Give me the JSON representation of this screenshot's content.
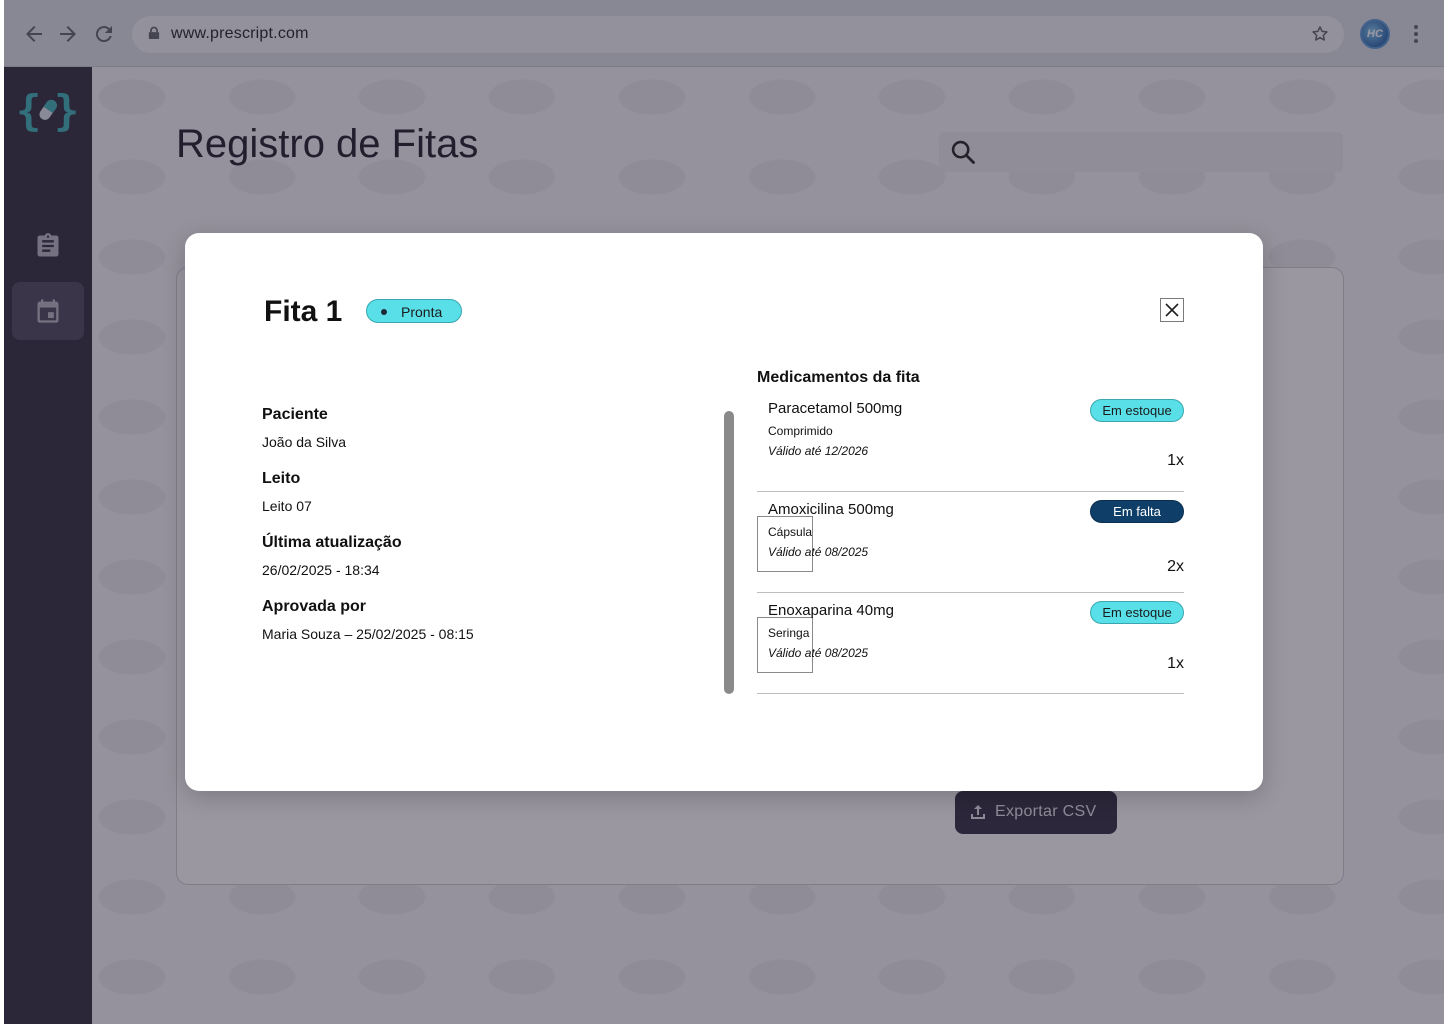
{
  "browser": {
    "url": "www.prescript.com",
    "avatar_initials": "HC"
  },
  "page": {
    "title": "Registro de Fitas",
    "search_placeholder": "",
    "export_label": "Exportar CSV"
  },
  "sidebar": {
    "items": [
      {
        "name": "clipboard-icon",
        "active": false
      },
      {
        "name": "calendar-icon",
        "active": true
      }
    ]
  },
  "modal": {
    "title": "Fita 1",
    "status": "Pronta",
    "fields": [
      {
        "label": "Paciente",
        "value": "João da Silva"
      },
      {
        "label": "Leito",
        "value": "Leito 07"
      },
      {
        "label": "Última atualização",
        "value": "26/02/2025 - 18:34"
      },
      {
        "label": "Aprovada por",
        "value": "Maria Souza – 25/02/2025 - 08:15"
      }
    ],
    "meds_title": "Medicamentos da fita",
    "meds": [
      {
        "name": "Paracetamol 500mg",
        "form": "Comprimido",
        "valid": "Válido até 12/2026",
        "status": "Em estoque",
        "qty": "1x"
      },
      {
        "name": "Amoxicilina 500mg",
        "form": "Cápsula",
        "valid": "Válido até 08/2025",
        "status": "Em falta",
        "qty": "2x"
      },
      {
        "name": "Enoxaparina 40mg",
        "form": "Seringa",
        "valid": "Válido até 08/2025",
        "status": "Em estoque",
        "qty": "1x"
      }
    ]
  },
  "colors": {
    "sidebar": "#2f2c3b",
    "accent_cyan": "#58dfe8",
    "status_out": "#0f3e68",
    "logo_teal": "#3bb3b8"
  }
}
